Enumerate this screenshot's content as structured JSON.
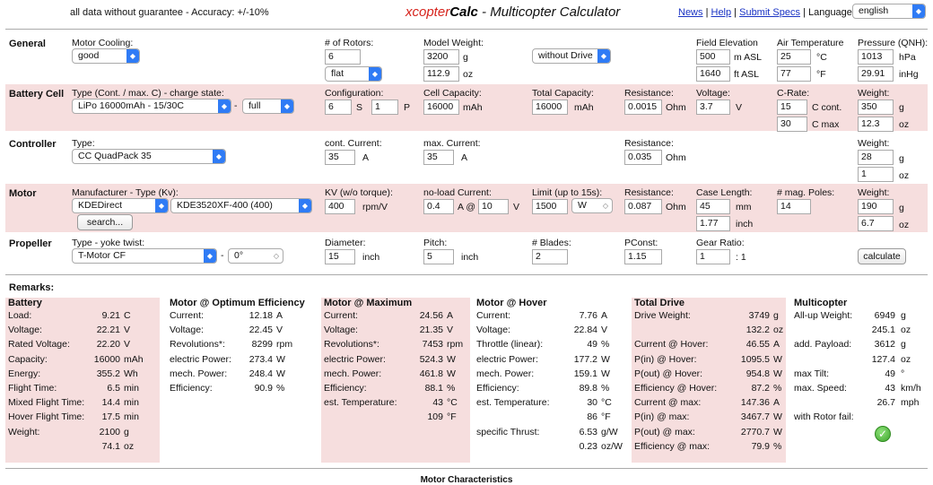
{
  "header": {
    "disclaimer": "all data without guarantee - Accuracy: +/-10%",
    "title_x": "xcopter",
    "title_calc": "Calc",
    "title_rest": " - Multicopter Calculator",
    "nav": [
      "News",
      "Help",
      "Submit Specs"
    ],
    "language_label": "Language:",
    "language_value": "english"
  },
  "general": {
    "section": "General",
    "motor_cooling_label": "Motor Cooling:",
    "motor_cooling": "good",
    "rotors_label": "# of Rotors:",
    "rotors": "6",
    "frame": "flat",
    "model_weight_label": "Model Weight:",
    "model_weight_g": "3200",
    "model_weight_oz": "112.9",
    "unit_g": "g",
    "unit_oz": "oz",
    "drive_mode": "without Drive",
    "field_elev_label": "Field Elevation",
    "field_elev_m": "500",
    "field_elev_m_unit": "m ASL",
    "field_elev_ft": "1640",
    "field_elev_ft_unit": "ft ASL",
    "air_temp_label": "Air Temperature",
    "air_temp_c": "25",
    "air_temp_f": "77",
    "unit_c": "°C",
    "unit_f": "°F",
    "pressure_label": "Pressure (QNH):",
    "pressure_hpa": "1013",
    "pressure_hpa_unit": "hPa",
    "pressure_inhg": "29.91",
    "pressure_inhg_unit": "inHg"
  },
  "battery": {
    "section": "Battery Cell",
    "type_label": "Type (Cont. / max. C) - charge state:",
    "type": "LiPo 16000mAh - 15/30C",
    "dash": "-",
    "charge": "full",
    "config_label": "Configuration:",
    "config_s": "6",
    "s": "S",
    "config_p": "1",
    "p": "P",
    "cell_cap_label": "Cell Capacity:",
    "cell_cap": "16000",
    "mah": "mAh",
    "total_cap_label": "Total Capacity:",
    "total_cap": "16000",
    "resistance_label": "Resistance:",
    "resistance": "0.0015",
    "ohm": "Ohm",
    "voltage_label": "Voltage:",
    "voltage": "3.7",
    "v": "V",
    "crate_label": "C-Rate:",
    "c_cont": "15",
    "c_cont_unit": "C cont.",
    "c_max": "30",
    "c_max_unit": "C max",
    "weight_label": "Weight:",
    "weight_g": "350",
    "weight_oz": "12.3",
    "g": "g",
    "oz": "oz"
  },
  "controller": {
    "section": "Controller",
    "type_label": "Type:",
    "type": "CC QuadPack 35",
    "cont_label": "cont. Current:",
    "cont": "35",
    "a": "A",
    "max_label": "max. Current:",
    "max": "35",
    "resistance_label": "Resistance:",
    "resistance": "0.035",
    "ohm": "Ohm",
    "weight_label": "Weight:",
    "weight_g": "28",
    "weight_oz": "1",
    "g": "g",
    "oz": "oz"
  },
  "motor": {
    "section": "Motor",
    "mfr_label": "Manufacturer - Type (Kv):",
    "manufacturer": "KDEDirect",
    "model": "KDE3520XF-400 (400)",
    "search": "search...",
    "kv_label": "KV (w/o torque):",
    "kv": "400",
    "kv_unit": "rpm/V",
    "noload_label": "no-load Current:",
    "noload": "0.4",
    "noload_at": "A @",
    "noload_v": "10",
    "v": "V",
    "limit_label": "Limit (up to 15s):",
    "limit": "1500",
    "limit_unit": "W",
    "resistance_label": "Resistance:",
    "resistance": "0.087",
    "ohm": "Ohm",
    "case_label": "Case Length:",
    "case_mm": "45",
    "mm": "mm",
    "case_in": "1.77",
    "inch": "inch",
    "poles_label": "# mag. Poles:",
    "poles": "14",
    "weight_label": "Weight:",
    "weight_g": "190",
    "weight_oz": "6.7",
    "g": "g",
    "oz": "oz"
  },
  "propeller": {
    "section": "Propeller",
    "type_label": "Type - yoke twist:",
    "type": "T-Motor CF",
    "dash": "-",
    "twist": "0°",
    "diameter_label": "Diameter:",
    "diameter": "15",
    "inch": "inch",
    "pitch_label": "Pitch:",
    "pitch": "5",
    "blades_label": "# Blades:",
    "blades": "2",
    "pconst_label": "PConst:",
    "pconst": "1.15",
    "gear_label": "Gear Ratio:",
    "gear": "1",
    "gear_unit": ": 1",
    "calculate": "calculate"
  },
  "remarks": {
    "title": "Remarks:",
    "battery": {
      "title": "Battery",
      "rows": [
        {
          "k": "Load:",
          "v": "9.21",
          "u": "C"
        },
        {
          "k": "Voltage:",
          "v": "22.21",
          "u": "V"
        },
        {
          "k": "Rated Voltage:",
          "v": "22.20",
          "u": "V"
        },
        {
          "k": "Capacity:",
          "v": "16000",
          "u": "mAh"
        },
        {
          "k": "Energy:",
          "v": "355.2",
          "u": "Wh"
        },
        {
          "k": "Flight Time:",
          "v": "6.5",
          "u": "min"
        },
        {
          "k": "Mixed Flight Time:",
          "v": "14.4",
          "u": "min"
        },
        {
          "k": "Hover Flight Time:",
          "v": "17.5",
          "u": "min"
        },
        {
          "k": "Weight:",
          "v": "2100",
          "u": "g"
        },
        {
          "k": "",
          "v": "74.1",
          "u": "oz"
        }
      ]
    },
    "optimum": {
      "title": "Motor @ Optimum Efficiency",
      "rows": [
        {
          "k": "Current:",
          "v": "12.18",
          "u": "A"
        },
        {
          "k": "Voltage:",
          "v": "22.45",
          "u": "V"
        },
        {
          "k": "Revolutions*:",
          "v": "8299",
          "u": "rpm"
        },
        {
          "k": "electric Power:",
          "v": "273.4",
          "u": "W"
        },
        {
          "k": "mech. Power:",
          "v": "248.4",
          "u": "W"
        },
        {
          "k": "Efficiency:",
          "v": "90.9",
          "u": "%"
        }
      ]
    },
    "maximum": {
      "title": "Motor @ Maximum",
      "rows": [
        {
          "k": "Current:",
          "v": "24.56",
          "u": "A"
        },
        {
          "k": "Voltage:",
          "v": "21.35",
          "u": "V"
        },
        {
          "k": "Revolutions*:",
          "v": "7453",
          "u": "rpm"
        },
        {
          "k": "electric Power:",
          "v": "524.3",
          "u": "W"
        },
        {
          "k": "mech. Power:",
          "v": "461.8",
          "u": "W"
        },
        {
          "k": "Efficiency:",
          "v": "88.1",
          "u": "%"
        },
        {
          "k": "est. Temperature:",
          "v": "43",
          "u": "°C"
        },
        {
          "k": "",
          "v": "109",
          "u": "°F"
        }
      ]
    },
    "hover": {
      "title": "Motor @ Hover",
      "rows": [
        {
          "k": "Current:",
          "v": "7.76",
          "u": "A"
        },
        {
          "k": "Voltage:",
          "v": "22.84",
          "u": "V"
        },
        {
          "k": "Throttle (linear):",
          "v": "49",
          "u": "%"
        },
        {
          "k": "electric Power:",
          "v": "177.2",
          "u": "W"
        },
        {
          "k": "mech. Power:",
          "v": "159.1",
          "u": "W"
        },
        {
          "k": "Efficiency:",
          "v": "89.8",
          "u": "%"
        },
        {
          "k": "est. Temperature:",
          "v": "30",
          "u": "°C"
        },
        {
          "k": "",
          "v": "86",
          "u": "°F"
        },
        {
          "k": "specific Thrust:",
          "v": "6.53",
          "u": "g/W"
        },
        {
          "k": "",
          "v": "0.23",
          "u": "oz/W"
        }
      ]
    },
    "total": {
      "title": "Total Drive",
      "rows": [
        {
          "k": "Drive Weight:",
          "v": "3749",
          "u": "g"
        },
        {
          "k": "",
          "v": "132.2",
          "u": "oz"
        },
        {
          "k": "Current @ Hover:",
          "v": "46.55",
          "u": "A"
        },
        {
          "k": "P(in) @ Hover:",
          "v": "1095.5",
          "u": "W"
        },
        {
          "k": "P(out) @ Hover:",
          "v": "954.8",
          "u": "W"
        },
        {
          "k": "Efficiency @ Hover:",
          "v": "87.2",
          "u": "%"
        },
        {
          "k": "Current @ max:",
          "v": "147.36",
          "u": "A"
        },
        {
          "k": "P(in) @ max:",
          "v": "3467.7",
          "u": "W"
        },
        {
          "k": "P(out) @ max:",
          "v": "2770.7",
          "u": "W"
        },
        {
          "k": "Efficiency @ max:",
          "v": "79.9",
          "u": "%"
        }
      ]
    },
    "multicopter": {
      "title": "Multicopter",
      "rows": [
        {
          "k": "All-up Weight:",
          "v": "6949",
          "u": "g"
        },
        {
          "k": "",
          "v": "245.1",
          "u": "oz"
        },
        {
          "k": "add. Payload:",
          "v": "3612",
          "u": "g"
        },
        {
          "k": "",
          "v": "127.4",
          "u": "oz"
        },
        {
          "k": "max Tilt:",
          "v": "49",
          "u": "°"
        },
        {
          "k": "max. Speed:",
          "v": "43",
          "u": "km/h"
        },
        {
          "k": "",
          "v": "26.7",
          "u": "mph"
        },
        {
          "k": "with Rotor fail:",
          "v": "",
          "u": ""
        }
      ]
    }
  },
  "bottom_title": "Motor Characteristics",
  "colors": {
    "pink": "#f6dede",
    "accent": "#2f7bf5",
    "title_red": "#d6231c"
  }
}
